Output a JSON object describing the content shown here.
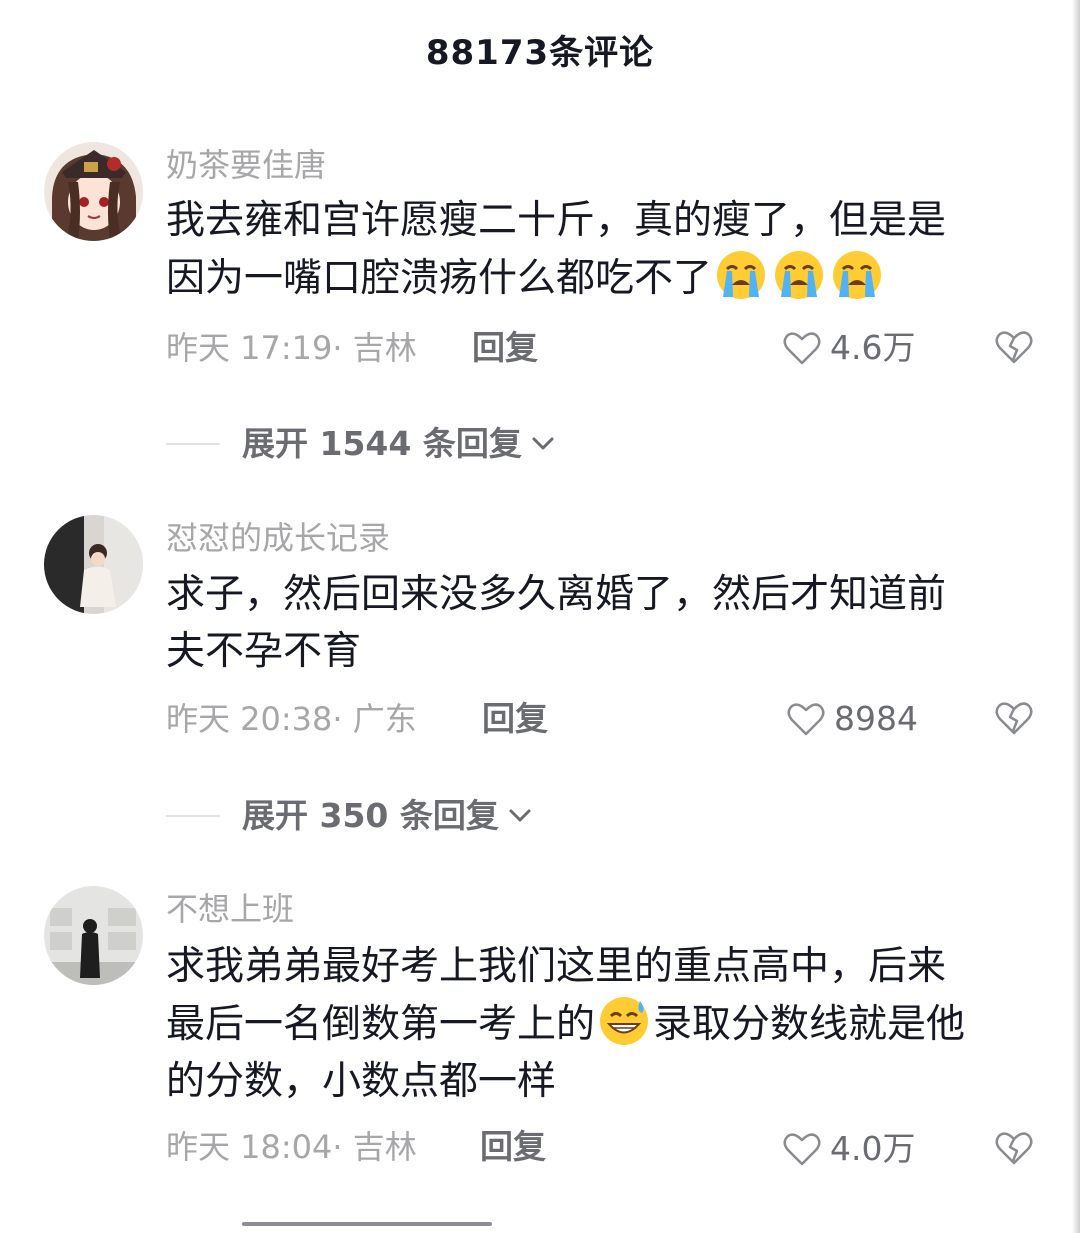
{
  "header": {
    "title": "88173条评论"
  },
  "comments": [
    {
      "username": "奶茶要佳唐",
      "text_line1": "我去雍和宫许愿瘦二十斤，真的瘦了，但是是",
      "text_line2": "因为一嘴口腔溃疡什么都吃不了",
      "emojis": [
        "loudly-crying-face-emoji",
        "loudly-crying-face-emoji",
        "loudly-crying-face-emoji"
      ],
      "meta": "昨天 17:19· 吉林",
      "reply_label": "回复",
      "likes": "4.6万",
      "expand_label": "展开 1544 条回复"
    },
    {
      "username": "怼怼的成长记录",
      "text_line1": "求子，然后回来没多久离婚了，然后才知道前",
      "text_line2": "夫不孕不育",
      "meta": "昨天 20:38· 广东",
      "reply_label": "回复",
      "likes": "8984",
      "expand_label": "展开 350 条回复"
    },
    {
      "username": "不想上班",
      "text_line1": "求我弟弟最好考上我们这里的重点高中，后来",
      "text_line2a": "最后一名倒数第一考上的",
      "emoji": "grinning-sweat-face-emoji",
      "text_line2b": "录取分数线就是他",
      "text_line3": "的分数，小数点都一样",
      "meta": "昨天 18:04· 吉林",
      "reply_label": "回复",
      "likes": "4.0万"
    }
  ],
  "colors": {
    "primary_text": "#161823",
    "secondary_text": "#a7a7a9",
    "action_text": "#6b6c72",
    "divider": "#e3e3e4"
  }
}
